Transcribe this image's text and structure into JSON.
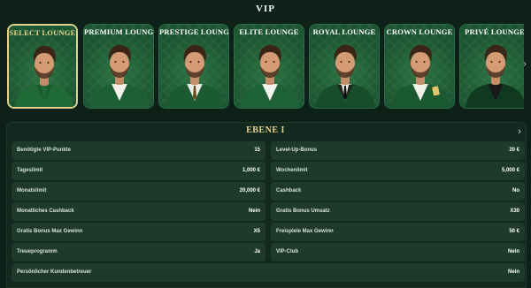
{
  "page": {
    "title": "VIP"
  },
  "lounges": [
    {
      "label": "SELECT LOUNGE",
      "outfit": "polo",
      "selected": true
    },
    {
      "label": "PREMIUM LOUNGE",
      "outfit": "vest"
    },
    {
      "label": "PRESTIGE LOUNGE",
      "outfit": "suit-tie"
    },
    {
      "label": "ELITE LOUNGE",
      "outfit": "suit"
    },
    {
      "label": "ROYAL LOUNGE",
      "outfit": "tuxedo"
    },
    {
      "label": "CROWN LOUNGE",
      "outfit": "suit-card"
    },
    {
      "label": "PRIVÉ LOUNGE",
      "outfit": "velvet"
    }
  ],
  "level": {
    "title": "EBENE I"
  },
  "benefits_left": [
    {
      "label": "Benötigte VIP-Punkte",
      "value": "15"
    },
    {
      "label": "Tageslimit",
      "value": "1,000 €"
    },
    {
      "label": "Monatslimit",
      "value": "20,000 €"
    },
    {
      "label": "Monatliches Cashback",
      "value": "Nein"
    },
    {
      "label": "Gratis Bonus Max Gewinn",
      "value": "X5"
    },
    {
      "label": "Treueprogramm",
      "value": "Ja"
    },
    {
      "label": "Persönlicher Kundenbetreuer",
      "value": "Nein"
    }
  ],
  "benefits_right": [
    {
      "label": "Level-Up-Bonus",
      "value": "20 €"
    },
    {
      "label": "Wochenlimit",
      "value": "5,000 €"
    },
    {
      "label": "Cashback",
      "value": "No"
    },
    {
      "label": "Gratis Bonus Umsatz",
      "value": "X30"
    },
    {
      "label": "Freispiele Max Gewinn",
      "value": "50 €"
    },
    {
      "label": "VIP-Club",
      "value": "Nein"
    }
  ],
  "icons": {
    "next_cards": "chevron-right-icon",
    "next_level": "chevron-right-icon"
  },
  "colors": {
    "accent_gold": "#e3d38d",
    "card_green": "#1b5a34",
    "background": "#0d2118"
  }
}
